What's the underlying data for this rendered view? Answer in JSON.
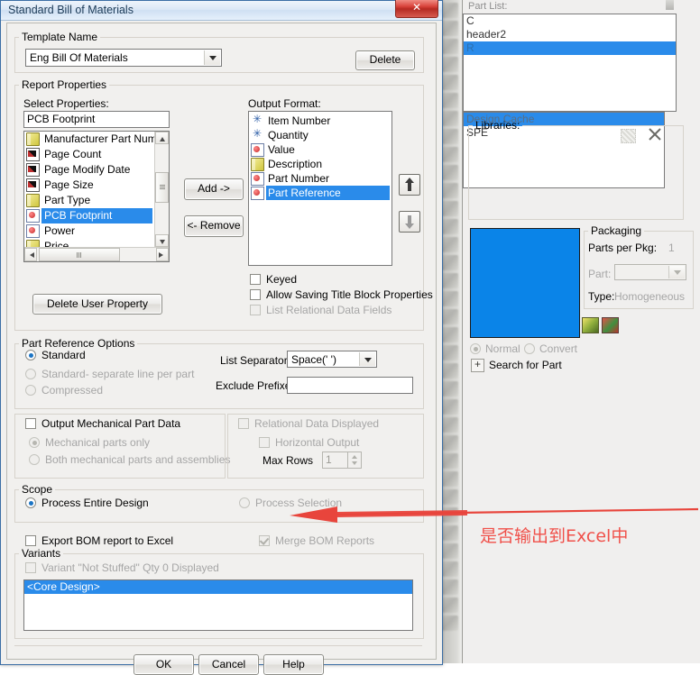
{
  "dialog": {
    "title": "Standard Bill of Materials",
    "close_label": "✕",
    "template_group": "Template Name",
    "template_value": "Eng Bill Of Materials",
    "delete_button": "Delete",
    "report_properties_group": "Report Properties",
    "select_properties_label": "Select Properties:",
    "select_properties_value": "PCB Footprint",
    "output_format_label": "Output Format:",
    "add_button": "Add ->",
    "remove_button": "<- Remove",
    "delete_user_property_button": "Delete User Property",
    "select_properties_items": [
      {
        "label": "Manufacturer Part Numbe",
        "icon": "doc-icon",
        "selected": false
      },
      {
        "label": "Page Count",
        "icon": "page-icon",
        "selected": false
      },
      {
        "label": "Page Modify Date",
        "icon": "page-icon",
        "selected": false
      },
      {
        "label": "Page Size",
        "icon": "page-icon",
        "selected": false
      },
      {
        "label": "Part Type",
        "icon": "doc-icon",
        "selected": false
      },
      {
        "label": "PCB Footprint",
        "icon": "prop-icon",
        "selected": true
      },
      {
        "label": "Power",
        "icon": "prop-icon",
        "selected": false
      },
      {
        "label": "Price",
        "icon": "doc-icon",
        "selected": false
      }
    ],
    "output_format_items": [
      {
        "label": "Item Number",
        "icon": "asterisk-icon",
        "selected": false
      },
      {
        "label": "Quantity",
        "icon": "asterisk-icon",
        "selected": false
      },
      {
        "label": "Value",
        "icon": "prop-icon",
        "selected": false
      },
      {
        "label": "Description",
        "icon": "doc-icon",
        "selected": false
      },
      {
        "label": "Part Number",
        "icon": "prop-icon",
        "selected": false
      },
      {
        "label": "Part Reference",
        "icon": "prop-icon",
        "selected": true
      }
    ],
    "move_up_icon": "arrow-up-icon",
    "move_down_icon": "arrow-down-icon",
    "checkboxes_output": [
      {
        "label": "Keyed",
        "checked": false,
        "disabled": false
      },
      {
        "label": "Allow Saving Title Block Properties",
        "checked": false,
        "disabled": false
      },
      {
        "label": "List Relational Data Fields",
        "checked": false,
        "disabled": true
      }
    ],
    "part_ref_group": "Part Reference Options",
    "part_ref_radios": [
      {
        "label": "Standard",
        "selected": true,
        "disabled": false
      },
      {
        "label": "Standard- separate line per part",
        "selected": false,
        "disabled": false
      },
      {
        "label": "Compressed",
        "selected": false,
        "disabled": false
      }
    ],
    "list_separator_label": "List Separator:",
    "list_separator_value": "Space(' ')",
    "exclude_prefixes_label": "Exclude Prefixes:",
    "exclude_prefixes_value": "",
    "output_mech_label": "Output Mechanical Part Data",
    "output_mech_checked": false,
    "mech_radios": [
      {
        "label": "Mechanical parts only",
        "selected": true,
        "disabled": true
      },
      {
        "label": "Both mechanical parts and assemblies",
        "selected": false,
        "disabled": true
      }
    ],
    "relational_label": "Relational Data Displayed",
    "relational_checked": false,
    "horizontal_label": "Horizontal Output",
    "horizontal_checked": false,
    "max_rows_label": "Max Rows",
    "max_rows_value": "1",
    "scope_group": "Scope",
    "scope_radios": [
      {
        "label": "Process Entire Design",
        "selected": true,
        "disabled": false
      },
      {
        "label": "Process Selection",
        "selected": false,
        "disabled": true
      }
    ],
    "export_excel_label": "Export BOM report to Excel",
    "export_excel_checked": false,
    "merge_bom_label": "Merge BOM Reports",
    "merge_bom_checked": true,
    "variants_group": "Variants",
    "variant_checkbox_label": "Variant \"Not Stuffed\" Qty 0 Displayed",
    "variant_checkbox_checked": false,
    "variants_items": [
      {
        "label": "<Core Design>",
        "selected": true
      }
    ],
    "ok_button": "OK",
    "cancel_button": "Cancel",
    "help_button": "Help"
  },
  "right_panel": {
    "part_list_label": "Part List:",
    "part_list_items": [
      {
        "label": "C",
        "selected": false
      },
      {
        "label": "header2",
        "selected": false
      },
      {
        "label": "R",
        "selected": true
      }
    ],
    "libraries_label": "Libraries:",
    "libraries_items": [
      {
        "label": "Design Cache",
        "selected": true
      },
      {
        "label": "SPE",
        "selected": false
      }
    ],
    "add_library_icon": "add-library-icon",
    "remove_library_icon": "close-x-icon",
    "packaging_group": "Packaging",
    "parts_per_pkg_label": "Parts per Pkg:",
    "parts_per_pkg_value": "1",
    "part_label": "Part:",
    "part_value": "",
    "type_label": "Type:",
    "type_value": "Homogeneous",
    "normal_label": "Normal",
    "convert_label": "Convert",
    "normal_selected": true,
    "search_for_part_label": "Search for Part",
    "expand_icon": "plus-icon",
    "preview_color": "#0a84e8",
    "tool_icons": [
      "edit-part-icon",
      "split-part-icon"
    ]
  },
  "annotation": {
    "text": "是否输出到Excel中",
    "color": "#f0504a",
    "arrow_icon": "red-arrow-left-icon"
  }
}
